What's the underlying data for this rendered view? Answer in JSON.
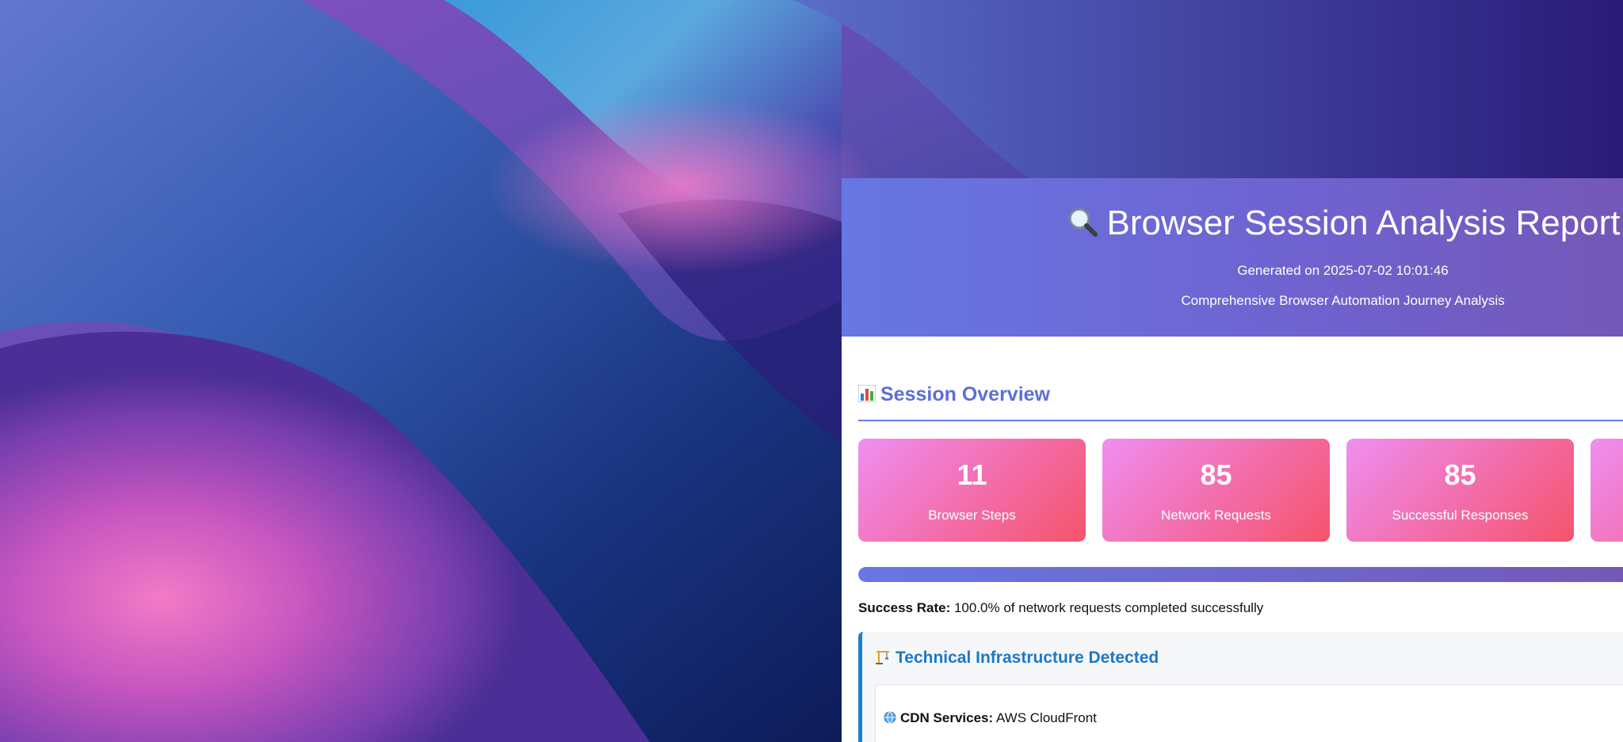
{
  "report": {
    "title": "Browser Session Analysis Report",
    "generated": "Generated on 2025-07-02 10:01:46",
    "description": "Comprehensive Browser Automation Journey Analysis"
  },
  "overview": {
    "title": "Session Overview",
    "stats": [
      {
        "value": "11",
        "label": "Browser Steps"
      },
      {
        "value": "85",
        "label": "Network Requests"
      },
      {
        "value": "85",
        "label": "Successful Responses"
      },
      {
        "value": "",
        "label": ""
      }
    ],
    "success_rate_fraction": 1.0,
    "success_label": "Success Rate:",
    "success_text": "100.0% of network requests completed successfully"
  },
  "infrastructure": {
    "title": "Technical Infrastructure Detected",
    "items": [
      {
        "label": "CDN Services:",
        "value": "AWS CloudFront"
      }
    ]
  },
  "icons": {
    "title_icon": "magnifier-icon",
    "overview_icon": "bar-chart-icon",
    "infra_icon": "construction-crane-icon",
    "cdn_icon": "globe-icon"
  },
  "colors": {
    "header_start": "#6777e3",
    "header_end": "#7458b8",
    "section_title": "#5b6fd9",
    "card_start": "#ef8ef1",
    "card_end": "#f5546a",
    "infra_accent": "#1e7fd6"
  }
}
